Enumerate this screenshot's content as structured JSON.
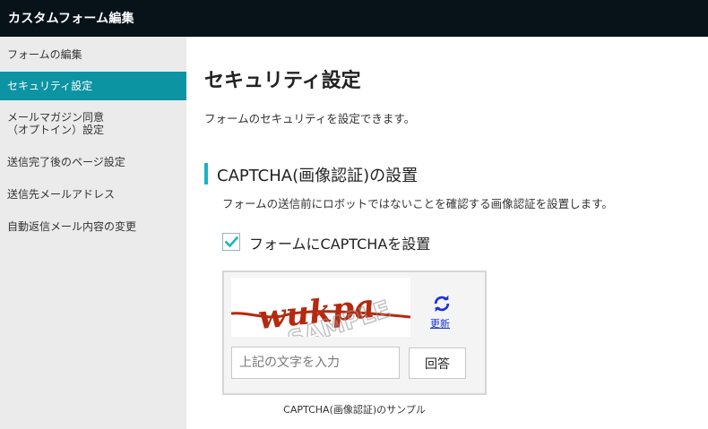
{
  "app": {
    "title": "カスタムフォーム編集"
  },
  "sidebar": {
    "items": [
      {
        "label": "フォームの編集",
        "active": false
      },
      {
        "label": "セキュリティ設定",
        "active": true
      },
      {
        "label_line1": "メールマガジン同意",
        "label_line2": "（オプトイン）設定",
        "active": false
      },
      {
        "label": "送信完了後のページ設定",
        "active": false
      },
      {
        "label": "送信先メールアドレス",
        "active": false
      },
      {
        "label": "自動返信メール内容の変更",
        "active": false
      }
    ]
  },
  "main": {
    "title": "セキュリティ設定",
    "description": "フォームのセキュリティを設定できます。",
    "section": {
      "title": "CAPTCHA(画像認証)の設置",
      "description": "フォームの送信前にロボットではないことを確認する画像認証を設置します。",
      "checkbox": {
        "label": "フォームにCAPTCHAを設置",
        "checked": true
      }
    },
    "captcha": {
      "image_text": "wukpa",
      "watermark": "SAMPLE",
      "refresh_label": "更新",
      "input_placeholder": "上記の文字を入力",
      "input_value": "",
      "answer_label": "回答",
      "caption": "CAPTCHA(画像認証)のサンプル"
    }
  },
  "colors": {
    "topbar": "#081219",
    "sidebar_bg": "#ebebeb",
    "active_item": "#0c94a3",
    "accent": "#19b3c6",
    "link": "#1a33d6",
    "captcha_text": "#b32a10"
  }
}
